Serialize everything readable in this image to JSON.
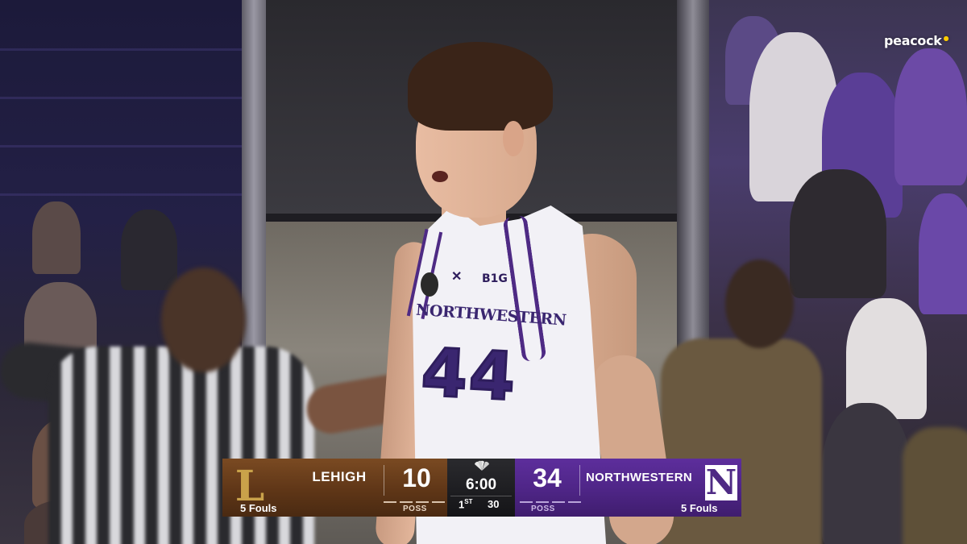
{
  "network": {
    "watermark": "peacock"
  },
  "jersey": {
    "wordmark": "NORTHWESTERN",
    "number": "44",
    "conference_badge": "B1G"
  },
  "scorebug": {
    "away": {
      "name": "LEHIGH",
      "score": "10",
      "fouls": "5 Fouls",
      "possession_label": "POSS",
      "logo_letter": "L",
      "color": "#5f3617"
    },
    "home": {
      "name": "NORTHWESTERN",
      "score": "34",
      "fouls": "5 Fouls",
      "possession_label": "POSS",
      "logo_letter": "N",
      "color": "#4e2586"
    },
    "clock": "6:00",
    "period": "1",
    "period_suffix": "ST",
    "shot_clock": "30",
    "broadcaster_icon": "peacock-network-icon"
  }
}
